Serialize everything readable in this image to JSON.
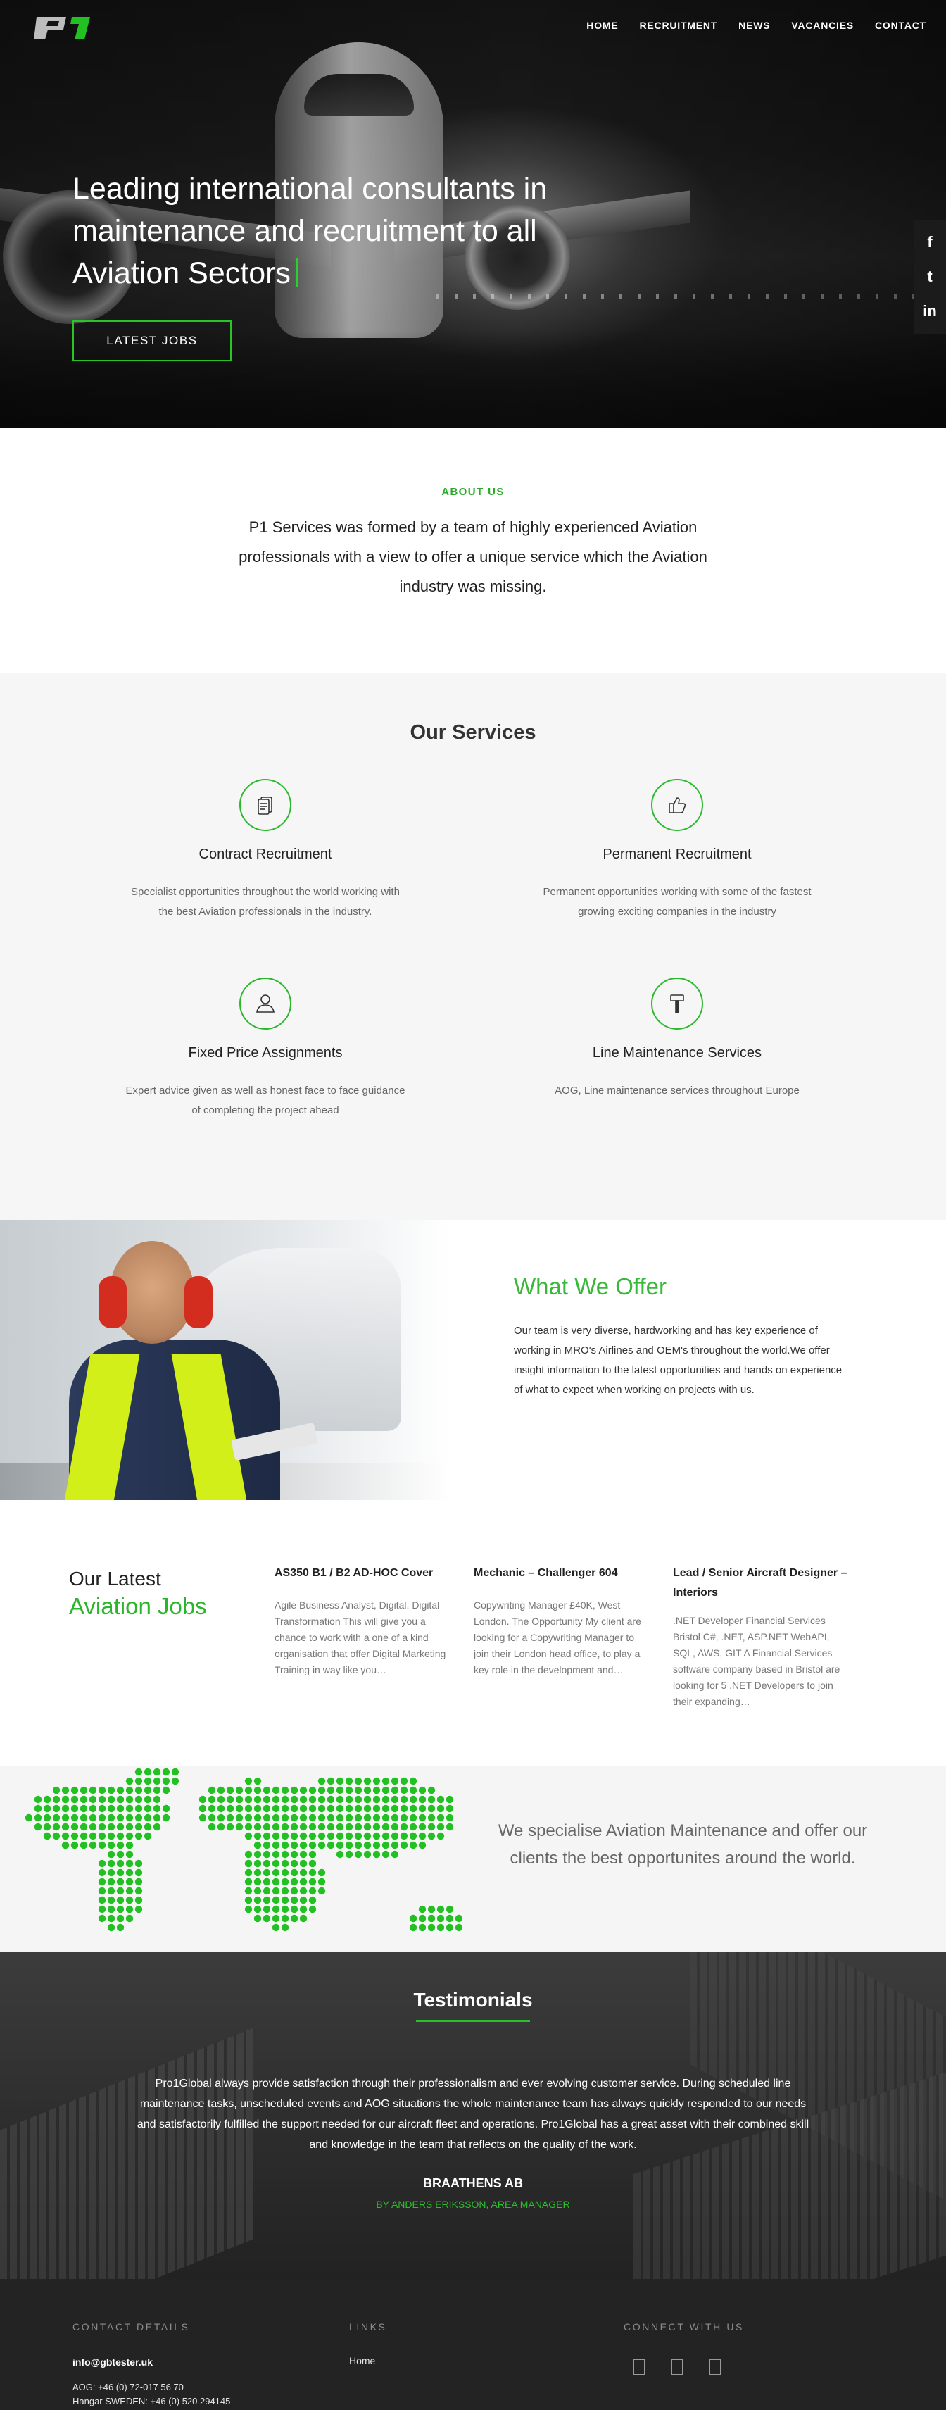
{
  "brand": {
    "logo_text": "P1",
    "accent": "#22c022"
  },
  "nav": {
    "items": [
      "HOME",
      "RECRUITMENT",
      "NEWS",
      "VACANCIES",
      "CONTACT"
    ]
  },
  "hero": {
    "title": "Leading international consultants in maintenance and recruitment to all Aviation Sectors",
    "cta_label": "LATEST JOBS"
  },
  "social_rail": {
    "icons": [
      "facebook-icon",
      "twitter-icon",
      "linkedin-icon"
    ],
    "glyphs": [
      "f",
      "t",
      "in"
    ]
  },
  "about": {
    "label": "ABOUT US",
    "text": "P1 Services was formed by a team of highly experienced Aviation professionals with a view to offer a unique service which the Aviation industry was missing."
  },
  "services": {
    "title": "Our Services",
    "items": [
      {
        "icon": "document-icon",
        "title": "Contract Recruitment",
        "text": "Specialist opportunities throughout the world working with the best Aviation professionals in the industry."
      },
      {
        "icon": "thumbs-up-icon",
        "title": "Permanent Recruitment",
        "text": "Permanent opportunities working with some of the fastest growing exciting companies in the industry"
      },
      {
        "icon": "person-icon",
        "title": "Fixed Price Assignments",
        "text": "Expert advice given as well as honest face to face guidance of completing the project ahead"
      },
      {
        "icon": "hammer-icon",
        "title": "Line Maintenance Services",
        "text": "AOG, Line maintenance services throughout Europe"
      }
    ]
  },
  "offer": {
    "title": "What We Offer",
    "text": "Our team is very diverse, hardworking and has key experience of working in MRO's Airlines and OEM's throughout the world.We offer insight information to the latest opportunities and hands on experience of what to expect when working on projects with us."
  },
  "jobs": {
    "heading_line1": "Our Latest",
    "heading_line2": "Aviation Jobs",
    "items": [
      {
        "title": "AS350 B1 / B2 AD-HOC Cover",
        "excerpt": "Agile Business Analyst, Digital, Digital Transformation This will give you a chance to work with a one of a kind organisation that offer Digital Marketing Training in way like you…"
      },
      {
        "title": "Mechanic – Challenger 604",
        "excerpt": "Copywriting Manager £40K, West London. The Opportunity My client are looking for a Copywriting Manager to join their London head office, to play a key role in the development and…"
      },
      {
        "title": "Lead / Senior Aircraft Designer – Interiors",
        "excerpt": ".NET Developer Financial Services Bristol C#, .NET, ASP.NET WebAPI, SQL, AWS, GIT A Financial Services software company based in Bristol are looking for 5 .NET Developers to join their expanding…"
      }
    ]
  },
  "map_strip": {
    "text": "We specialise Aviation Maintenance and offer our clients the best opportunites around the world."
  },
  "testimonials": {
    "title": "Testimonials",
    "quote": "Pro1Global always provide satisfaction through their professionalism and ever evolving customer service. During scheduled line maintenance tasks, unscheduled events and AOG situations the whole maintenance team has always quickly responded to our needs and satisfactorily fulfilled the support needed for our aircraft fleet and operations. Pro1Global has a great asset with their combined skill and knowledge in the team that reflects on the quality of the work.",
    "company": "BRAATHENS AB",
    "person": "BY ANDERS ERIKSSON, AREA MANAGER"
  },
  "footer": {
    "contact_heading": "CONTACT DETAILS",
    "links_heading": "LINKS",
    "connect_heading": "CONNECT WITH US",
    "email": "info@gbtester.uk",
    "aog": "AOG: +46 (0) 72-017 56 70",
    "hangar": "Hangar SWEDEN: +46 (0) 520 294145",
    "links": [
      "Home"
    ],
    "social_icons": [
      "facebook-icon",
      "twitter-icon",
      "linkedin-icon"
    ]
  }
}
